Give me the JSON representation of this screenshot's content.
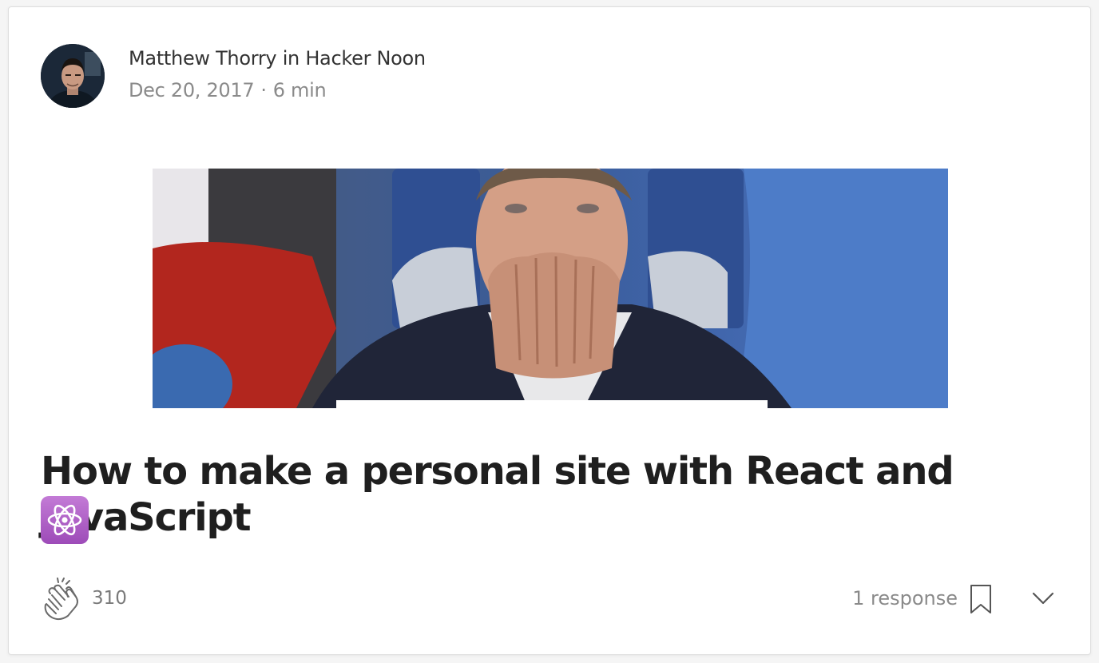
{
  "post": {
    "author": "Matthew Thorry",
    "in_word": "in",
    "publication": "Hacker Noon",
    "date": "Dec 20, 2017",
    "separator": "·",
    "read_time": "6 min",
    "title": "How to make a personal site with React and JavaScript",
    "title_emoji": "atom-symbol-icon",
    "claps": "310",
    "responses": "1 response"
  },
  "colors": {
    "title": "#1f1f1f",
    "meta_muted": "#8a8a8a",
    "atom_badge": "#b063c8"
  },
  "icons": {
    "clap": "clap-hands-icon",
    "bookmark": "bookmark-icon",
    "more": "chevron-down-icon"
  }
}
